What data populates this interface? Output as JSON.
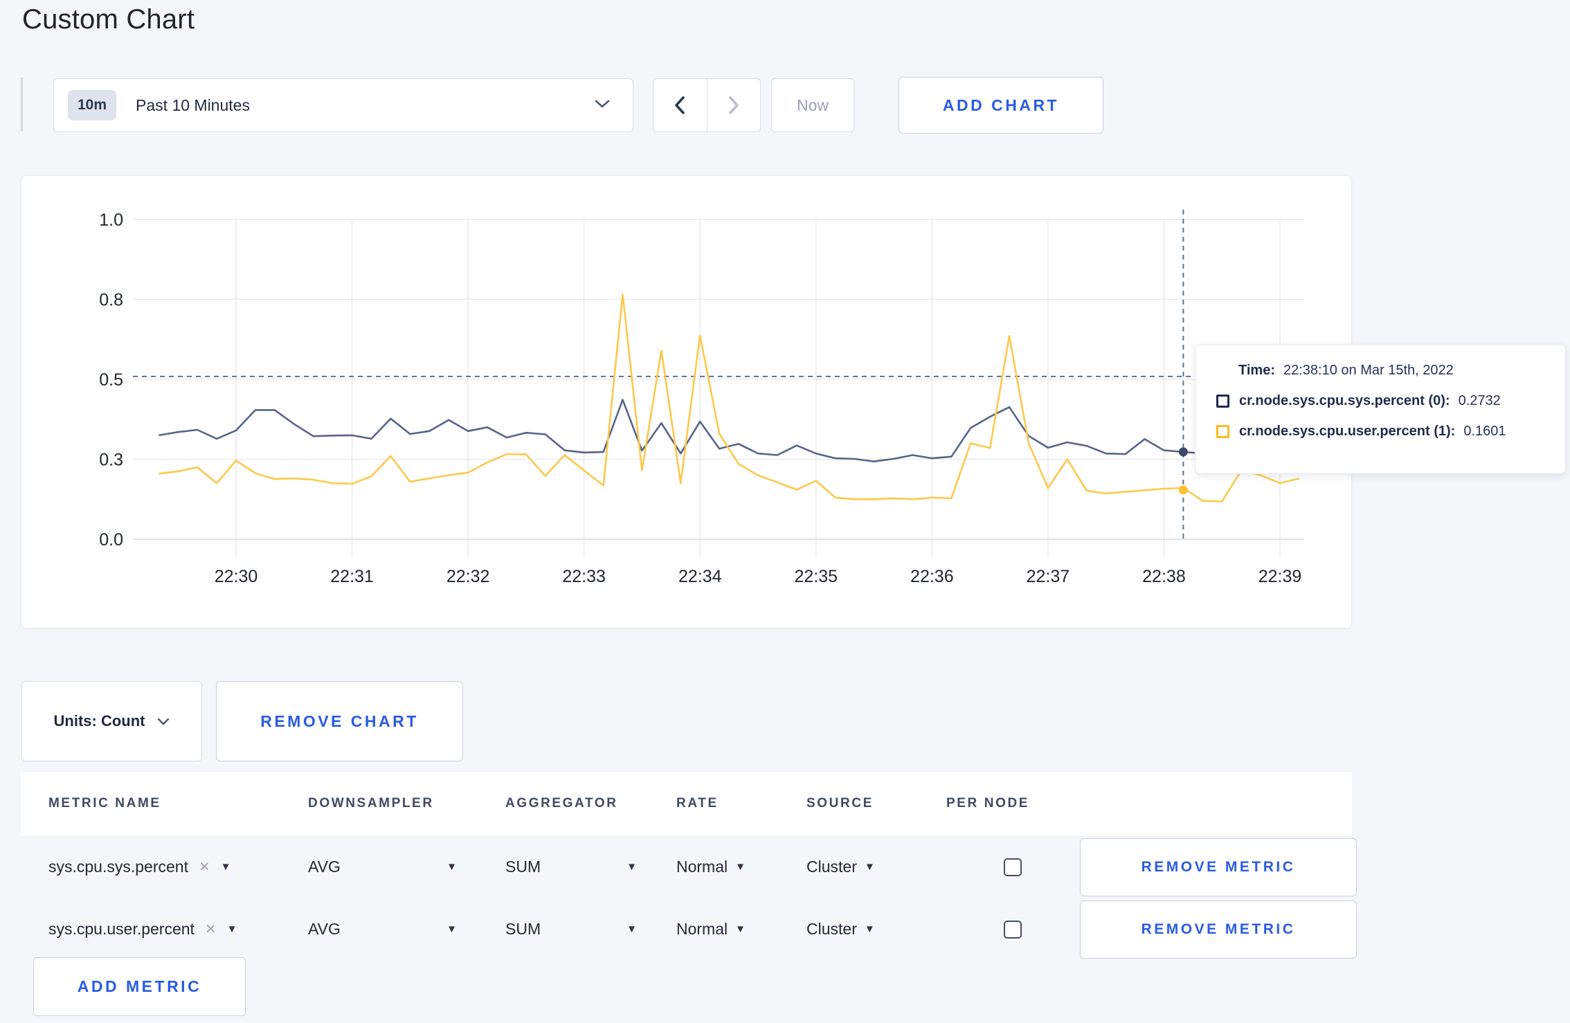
{
  "page": {
    "title": "Custom Chart",
    "accent_blue": "#2a5ce4"
  },
  "toolbar": {
    "time_range": {
      "badge": "10m",
      "label": "Past 10 Minutes"
    },
    "now_label": "Now",
    "add_chart_label": "ADD CHART"
  },
  "chart_controls": {
    "units_label": "Units: Count",
    "remove_chart_label": "REMOVE CHART"
  },
  "chart_data": {
    "type": "line",
    "title": "",
    "xlabel": "",
    "ylabel": "",
    "ylim": [
      0,
      1
    ],
    "grid": true,
    "x_tick_labels": [
      "22:30",
      "22:31",
      "22:32",
      "22:33",
      "22:34",
      "22:35",
      "22:36",
      "22:37",
      "22:38",
      "22:39"
    ],
    "y_ticks": [
      {
        "value": 0,
        "label": "0.0"
      },
      {
        "value": 0.25,
        "label": "0.3"
      },
      {
        "value": 0.5,
        "label": "0.5"
      },
      {
        "value": 0.75,
        "label": "0.8"
      },
      {
        "value": 1.0,
        "label": "1.0"
      }
    ],
    "start_offset_min": -0.6667,
    "x_step_seconds": 10,
    "series": [
      {
        "name": "cr.node.sys.cpu.sys.percent",
        "color": "#566489",
        "values": [
          0.325,
          0.335,
          0.342,
          0.314,
          0.34,
          0.404,
          0.404,
          0.36,
          0.322,
          0.324,
          0.325,
          0.314,
          0.377,
          0.329,
          0.338,
          0.373,
          0.338,
          0.35,
          0.318,
          0.333,
          0.328,
          0.278,
          0.271,
          0.273,
          0.436,
          0.277,
          0.363,
          0.268,
          0.368,
          0.283,
          0.298,
          0.268,
          0.263,
          0.293,
          0.268,
          0.253,
          0.251,
          0.243,
          0.251,
          0.263,
          0.253,
          0.258,
          0.348,
          0.383,
          0.413,
          0.323,
          0.286,
          0.303,
          0.292,
          0.268,
          0.266,
          0.313,
          0.278,
          0.273,
          0.268,
          0.272,
          0.28,
          0.272,
          0.268,
          0.272
        ]
      },
      {
        "name": "cr.node.sys.cpu.user.percent",
        "color": "#fcc94b",
        "values": [
          0.205,
          0.212,
          0.225,
          0.175,
          0.246,
          0.206,
          0.188,
          0.19,
          0.186,
          0.175,
          0.173,
          0.197,
          0.26,
          0.18,
          0.19,
          0.2,
          0.208,
          0.24,
          0.266,
          0.265,
          0.198,
          0.263,
          0.215,
          0.168,
          0.765,
          0.215,
          0.59,
          0.175,
          0.637,
          0.33,
          0.235,
          0.2,
          0.178,
          0.155,
          0.183,
          0.13,
          0.125,
          0.125,
          0.128,
          0.125,
          0.13,
          0.128,
          0.3,
          0.285,
          0.635,
          0.3,
          0.16,
          0.25,
          0.152,
          0.143,
          0.148,
          0.153,
          0.158,
          0.16,
          0.12,
          0.118,
          0.215,
          0.2,
          0.175,
          0.19
        ]
      }
    ],
    "crosshair": {
      "x_minutes_after_2230": 8.1667,
      "y_value": 0.509,
      "markers": [
        {
          "series": 0,
          "value": 0.273,
          "color": "#3d4b69"
        },
        {
          "series": 1,
          "value": 0.154,
          "color": "#fdc030"
        }
      ]
    },
    "tooltip": {
      "time_label": "Time:",
      "time_value": "22:38:10 on Mar 15th, 2022",
      "rows": [
        {
          "label": "cr.node.sys.cpu.sys.percent (0):",
          "value": "0.2732",
          "swatch": "#1e2c4e"
        },
        {
          "label": "cr.node.sys.cpu.user.percent (1):",
          "value": "0.1601",
          "swatch": "#fdbb1c"
        }
      ]
    }
  },
  "metrics_table": {
    "headers": [
      "METRIC NAME",
      "DOWNSAMPLER",
      "AGGREGATOR",
      "RATE",
      "SOURCE",
      "PER NODE"
    ],
    "close_char": "×",
    "caret_char": "▼",
    "rows": [
      {
        "metric": "sys.cpu.sys.percent",
        "downsampler": "AVG",
        "aggregator": "SUM",
        "rate": "Normal",
        "source": "Cluster",
        "per_node_checked": false,
        "remove_label": "REMOVE METRIC"
      },
      {
        "metric": "sys.cpu.user.percent",
        "downsampler": "AVG",
        "aggregator": "SUM",
        "rate": "Normal",
        "source": "Cluster",
        "per_node_checked": false,
        "remove_label": "REMOVE METRIC"
      }
    ],
    "add_metric_label": "ADD METRIC"
  }
}
